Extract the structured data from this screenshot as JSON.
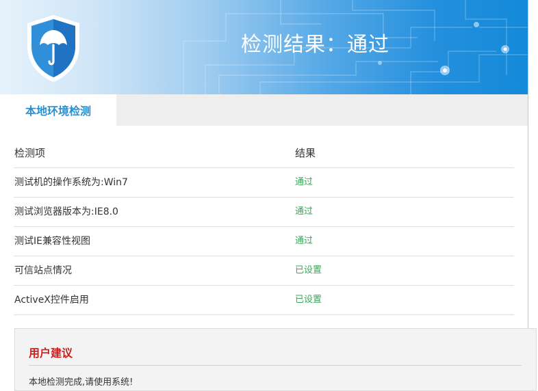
{
  "banner": {
    "title": "检测结果：通过",
    "logo_icon": "umbrella-shield-icon",
    "colors": {
      "start": "#e6f2fb",
      "end": "#138ad9"
    }
  },
  "tabs": [
    {
      "label": "本地环境检测",
      "active": true
    }
  ],
  "table": {
    "headers": {
      "item": "检测项",
      "result": "结果"
    },
    "rows": [
      {
        "item": "测试机的操作系统为:Win7",
        "result": "通过"
      },
      {
        "item": "测试浏览器版本为:IE8.0",
        "result": "通过"
      },
      {
        "item": "测试IE兼容性视图",
        "result": "通过"
      },
      {
        "item": "可信站点情况",
        "result": "已设置"
      },
      {
        "item": "ActiveX控件启用",
        "result": "已设置"
      }
    ],
    "result_color": "#3aa55c"
  },
  "suggestion": {
    "title": "用户建议",
    "text": "本地检测完成,请使用系统!",
    "title_color": "#cc1f1f"
  }
}
